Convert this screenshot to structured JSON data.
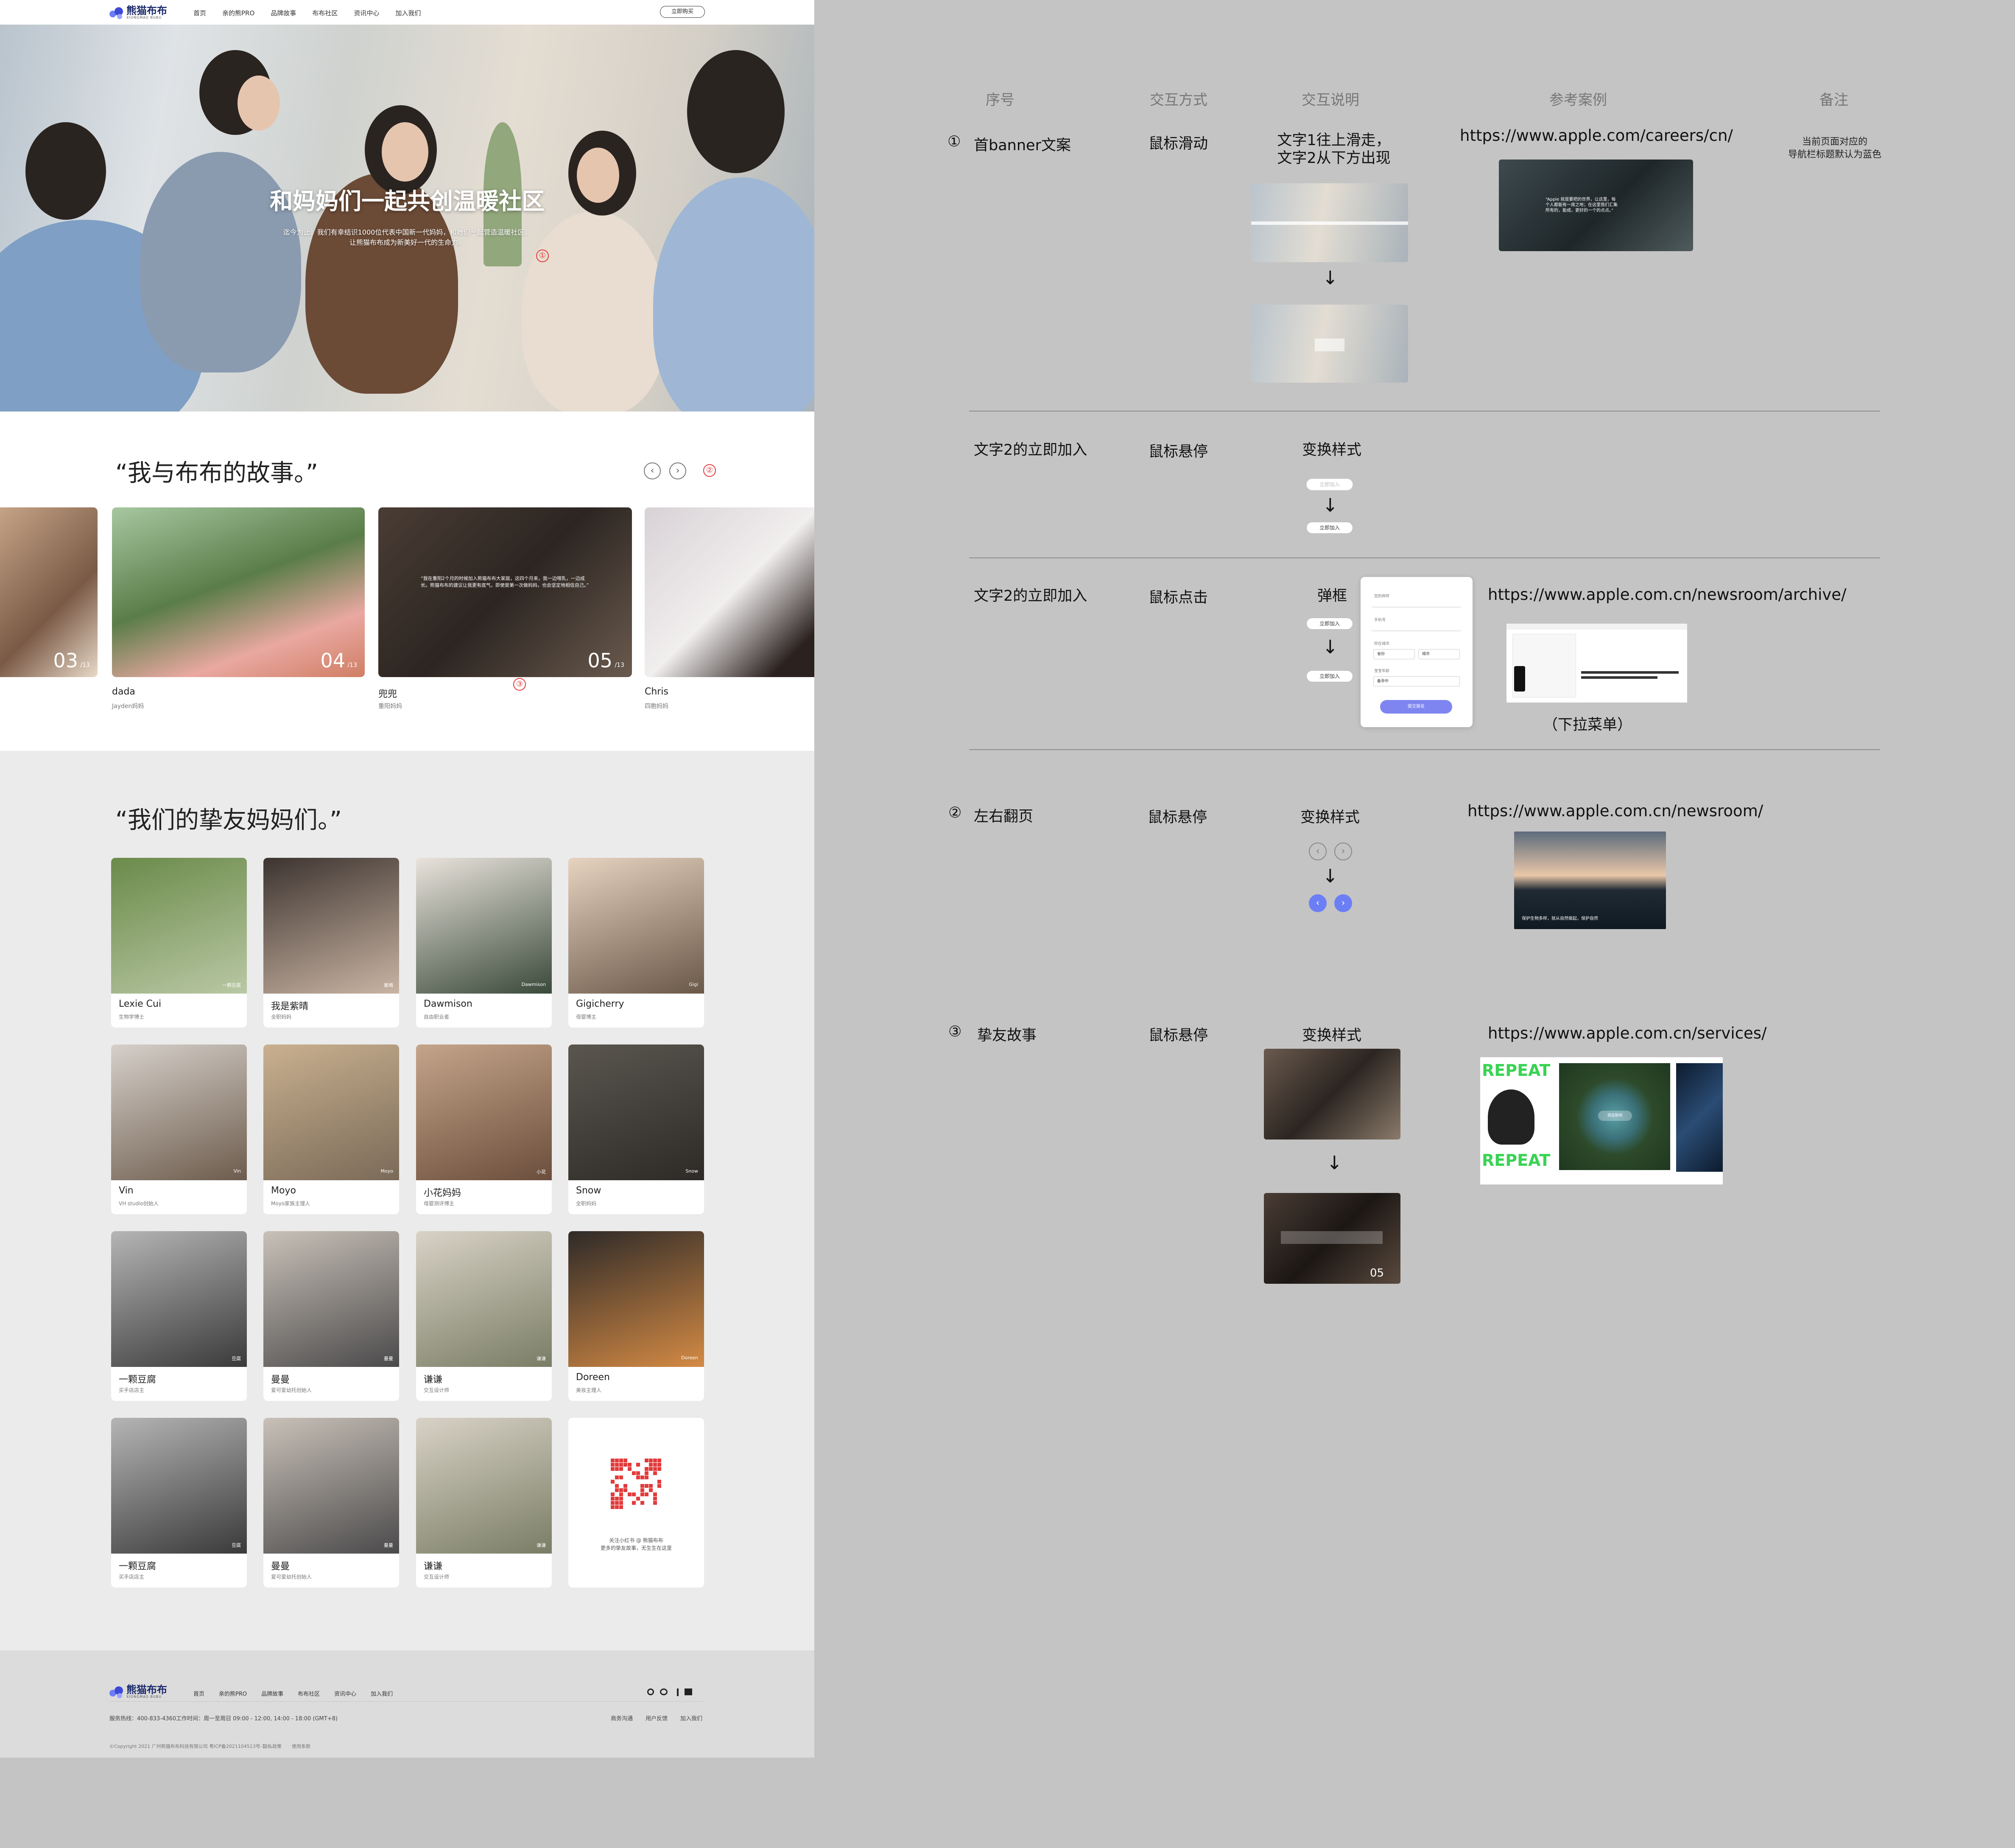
{
  "site": {
    "logo": {
      "name": "熊猫布布",
      "tagline": "XIONGMAO BUBU"
    },
    "nav": [
      "首页",
      "亲的熊PRO",
      "品牌故事",
      "布布社区",
      "资讯中心",
      "加入我们"
    ],
    "nav_button": "立即购买",
    "hero": {
      "title": "和妈妈们一起共创温暖社区",
      "subtitle": "迄今为止，我们有幸结识1000位代表中国新一代妈妈，和她们一起营造温暖社区，让熊猫布布成为新美好一代的生命力。",
      "marker": "①"
    },
    "stories": {
      "title": "“我与布布的故事。”",
      "prev_icon": "‹",
      "next_icon": "›",
      "marker_nav": "②",
      "marker_card": "③",
      "cards": [
        {
          "num": "03",
          "total": "/13",
          "name": "",
          "role": ""
        },
        {
          "num": "04",
          "total": "/13",
          "name": "dada",
          "role": "Jayden妈妈"
        },
        {
          "num": "05",
          "total": "/13",
          "name": "兜兜",
          "role": "重阳妈妈",
          "quote": "“我在重阳2个月的时候加入熊猫布布大家庭，这四个月来，我一边喂乳，一边成长。熊猫布布的建议让我更有底气，即使是第一次做妈妈，也会坚定地相信自己。”"
        },
        {
          "num": "",
          "total": "",
          "name": "Chris",
          "role": "四胞妈妈"
        }
      ]
    },
    "friends": {
      "title": "“我们的挚友妈妈们。”",
      "cards": [
        {
          "name": "Lexie Cui",
          "role": "生物学博士",
          "tag": "一颗豆腐"
        },
        {
          "name": "我是紫晴",
          "role": "全职妈妈",
          "tag": "紫晴"
        },
        {
          "name": "Dawmison",
          "role": "自由职业者",
          "tag": "Dawmison"
        },
        {
          "name": "Gigicherry",
          "role": "母婴博主",
          "tag": "Gigi"
        },
        {
          "name": "Vin",
          "role": "VH studio创始人",
          "tag": "Vin"
        },
        {
          "name": "Moyo",
          "role": "Moyo家族主理人",
          "tag": "Moyo"
        },
        {
          "name": "小花妈妈",
          "role": "母婴测评博主",
          "tag": "小花"
        },
        {
          "name": "Snow",
          "role": "全职妈妈",
          "tag": "Snow"
        },
        {
          "name": "一颗豆腐",
          "role": "买手店店主",
          "tag": "豆腐"
        },
        {
          "name": "曼曼",
          "role": "爱可爱幼托创始人",
          "tag": "曼曼"
        },
        {
          "name": "谦谦",
          "role": "交互设计师",
          "tag": "谦谦"
        },
        {
          "name": "Doreen",
          "role": "美妆主理人",
          "tag": "Doreen"
        },
        {
          "name": "一颗豆腐",
          "role": "买手店店主",
          "tag": "豆腐"
        },
        {
          "name": "曼曼",
          "role": "爱可爱幼托创始人",
          "tag": "曼曼"
        },
        {
          "name": "谦谦",
          "role": "交互设计师",
          "tag": "谦谦"
        }
      ],
      "qr_note": "关注小红书 @ 熊猫布布\n更多的挚友故事，无生生在这里"
    },
    "footer": {
      "nav": [
        "首页",
        "亲的熊PRO",
        "品牌故事",
        "布布社区",
        "资讯中心",
        "加入我们"
      ],
      "hotline": "服务热线：400-833-4360工作时间：周一至周日 09:00 - 12:00, 14:00 - 18:00 (GMT+8)",
      "links": [
        "商务沟通",
        "用户反馈",
        "加入我们"
      ],
      "copyright": "©Copyright 2021 广州熊猫布布科技有限公司 粤ICP备2021104513号-1",
      "legal": [
        "隐私政策",
        "使用条款"
      ]
    }
  },
  "spec": {
    "headers": [
      "序号",
      "交互方式",
      "交互说明",
      "参考案例",
      "备注"
    ],
    "rows": [
      {
        "index": "①",
        "name": "首banner文案",
        "method": "鼠标滑动",
        "desc": "文字1往上滑走，\n文字2从下方出现",
        "url": "https://www.apple.com/careers/cn/",
        "note": "当前页面对应的\n导航栏标题默认为蓝色",
        "ref_caption": "“Apple 就是要把的世界，让这里，每个人都能有一席之地；在这里我们汇集所有的，能成，更好的一个的点点。”"
      },
      {
        "index": "",
        "name": "文字2的立即加入",
        "method": "鼠标悬停",
        "desc": "变换样式",
        "pill": "立即加入"
      },
      {
        "index": "",
        "name": "文字2的立即加入",
        "method": "鼠标点击",
        "desc": "弹框",
        "url": "https://www.apple.com.cn/newsroom/archive/",
        "caption": "（下拉菜单）",
        "pill": "立即加入",
        "modal": {
          "labels": [
            "您的称呼",
            "手机号",
            "所在城市",
            "宝宝年龄"
          ],
          "province": "省份",
          "city": "城市",
          "stage": "备孕中",
          "submit": "提交报名"
        }
      },
      {
        "index": "②",
        "name": "左右翻页",
        "method": "鼠标悬停",
        "desc": "变换样式",
        "url": "https://www.apple.com.cn/newsroom/",
        "ref_caption": "保护生物多样，就从自然做起，保护自然"
      },
      {
        "index": "③",
        "name": "挚友故事",
        "method": "鼠标悬停",
        "desc": "变换样式",
        "url": "https://www.apple.com.cn/services/",
        "thumb_num": "05",
        "ref_text": "REPEAT",
        "ref_button": "现在聆听"
      }
    ],
    "arrow": "↓"
  },
  "colors": {
    "accent": "#6c7ef6",
    "marker": "#e23b3b",
    "bg_canvas": "#c4c4c4",
    "bg_friends": "#ebebeb"
  }
}
